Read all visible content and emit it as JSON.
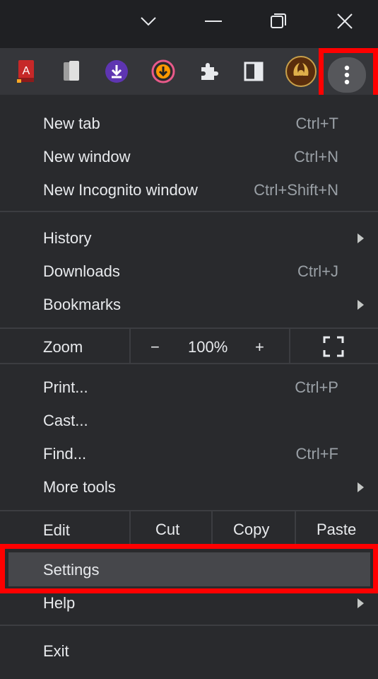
{
  "window": {
    "controls": [
      "chevron-down-icon",
      "minimize-icon",
      "restore-icon",
      "close-icon"
    ]
  },
  "toolbar": {
    "extensions": [
      "pdf-reader-icon",
      "pages-icon",
      "download-icon",
      "downloader-icon",
      "puzzle-icon",
      "side-panel-icon",
      "profile-icon"
    ],
    "menu_button": "three-dot-menu-icon"
  },
  "menu": {
    "new_tab": {
      "label": "New tab",
      "shortcut": "Ctrl+T"
    },
    "new_window": {
      "label": "New window",
      "shortcut": "Ctrl+N"
    },
    "new_incognito": {
      "label": "New Incognito window",
      "shortcut": "Ctrl+Shift+N"
    },
    "history": {
      "label": "History"
    },
    "downloads": {
      "label": "Downloads",
      "shortcut": "Ctrl+J"
    },
    "bookmarks": {
      "label": "Bookmarks"
    },
    "zoom": {
      "label": "Zoom",
      "minus": "−",
      "value": "100%",
      "plus": "+"
    },
    "print": {
      "label": "Print...",
      "shortcut": "Ctrl+P"
    },
    "cast": {
      "label": "Cast..."
    },
    "find": {
      "label": "Find...",
      "shortcut": "Ctrl+F"
    },
    "more_tools": {
      "label": "More tools"
    },
    "edit": {
      "label": "Edit",
      "cut": "Cut",
      "copy": "Copy",
      "paste": "Paste"
    },
    "settings": {
      "label": "Settings"
    },
    "help": {
      "label": "Help"
    },
    "exit": {
      "label": "Exit"
    }
  },
  "colors": {
    "menu_bg": "#292a2d",
    "highlight": "#ff0000",
    "hover": "#46474b"
  }
}
